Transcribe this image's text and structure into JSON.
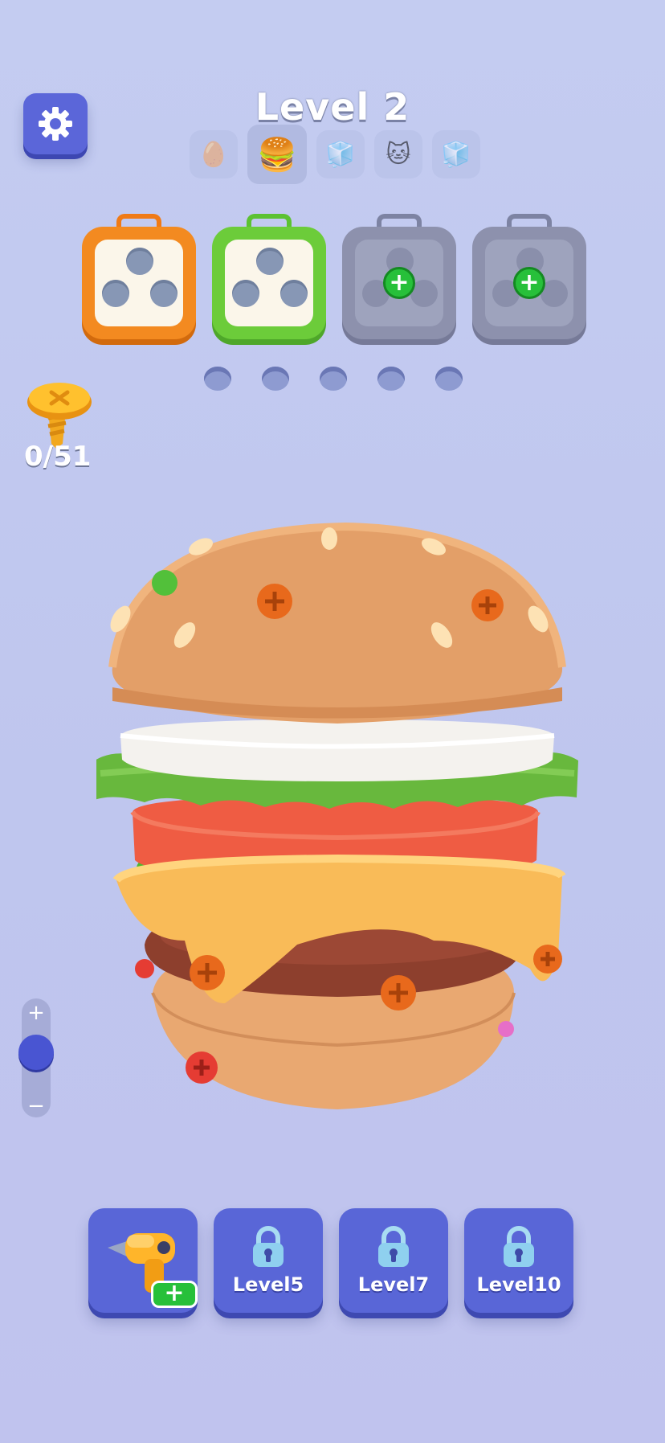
{
  "header": {
    "title": "Level 2"
  },
  "level_track": [
    {
      "name": "egg",
      "emoji": "🥚",
      "state": "locked"
    },
    {
      "name": "burger",
      "emoji": "🍔",
      "state": "current"
    },
    {
      "name": "cubes",
      "emoji": "🧊",
      "state": "locked"
    },
    {
      "name": "robot-cat",
      "emoji": "🐱",
      "state": "locked"
    },
    {
      "name": "cubes",
      "emoji": "🧊",
      "state": "locked"
    }
  ],
  "boxes": [
    {
      "color": "orange",
      "hex": "#f38a20",
      "holes": 3,
      "locked": false
    },
    {
      "color": "green",
      "hex": "#6ccc3a",
      "holes": 3,
      "locked": false
    },
    {
      "color": "grey",
      "hex": "#8d91ad",
      "holes": 3,
      "locked": true,
      "unlock_label": "+"
    },
    {
      "color": "grey",
      "hex": "#8d91ad",
      "holes": 3,
      "locked": true,
      "unlock_label": "+"
    }
  ],
  "queue_slots": 5,
  "screw_counter": {
    "text": "0/51",
    "collected": 0,
    "total": 51
  },
  "zoom": {
    "plus_label": "+",
    "minus_label": "−"
  },
  "bottom_bar": {
    "drill": {
      "icon": "drill-icon",
      "badge": "+"
    },
    "locked_items": [
      {
        "label": "Level5",
        "icon": "lock-icon"
      },
      {
        "label": "Level7",
        "icon": "lock-icon"
      },
      {
        "label": "Level10",
        "icon": "lock-icon"
      }
    ]
  },
  "colors": {
    "accent_blue": "#5b66d9",
    "plus_green": "#27c03a"
  }
}
